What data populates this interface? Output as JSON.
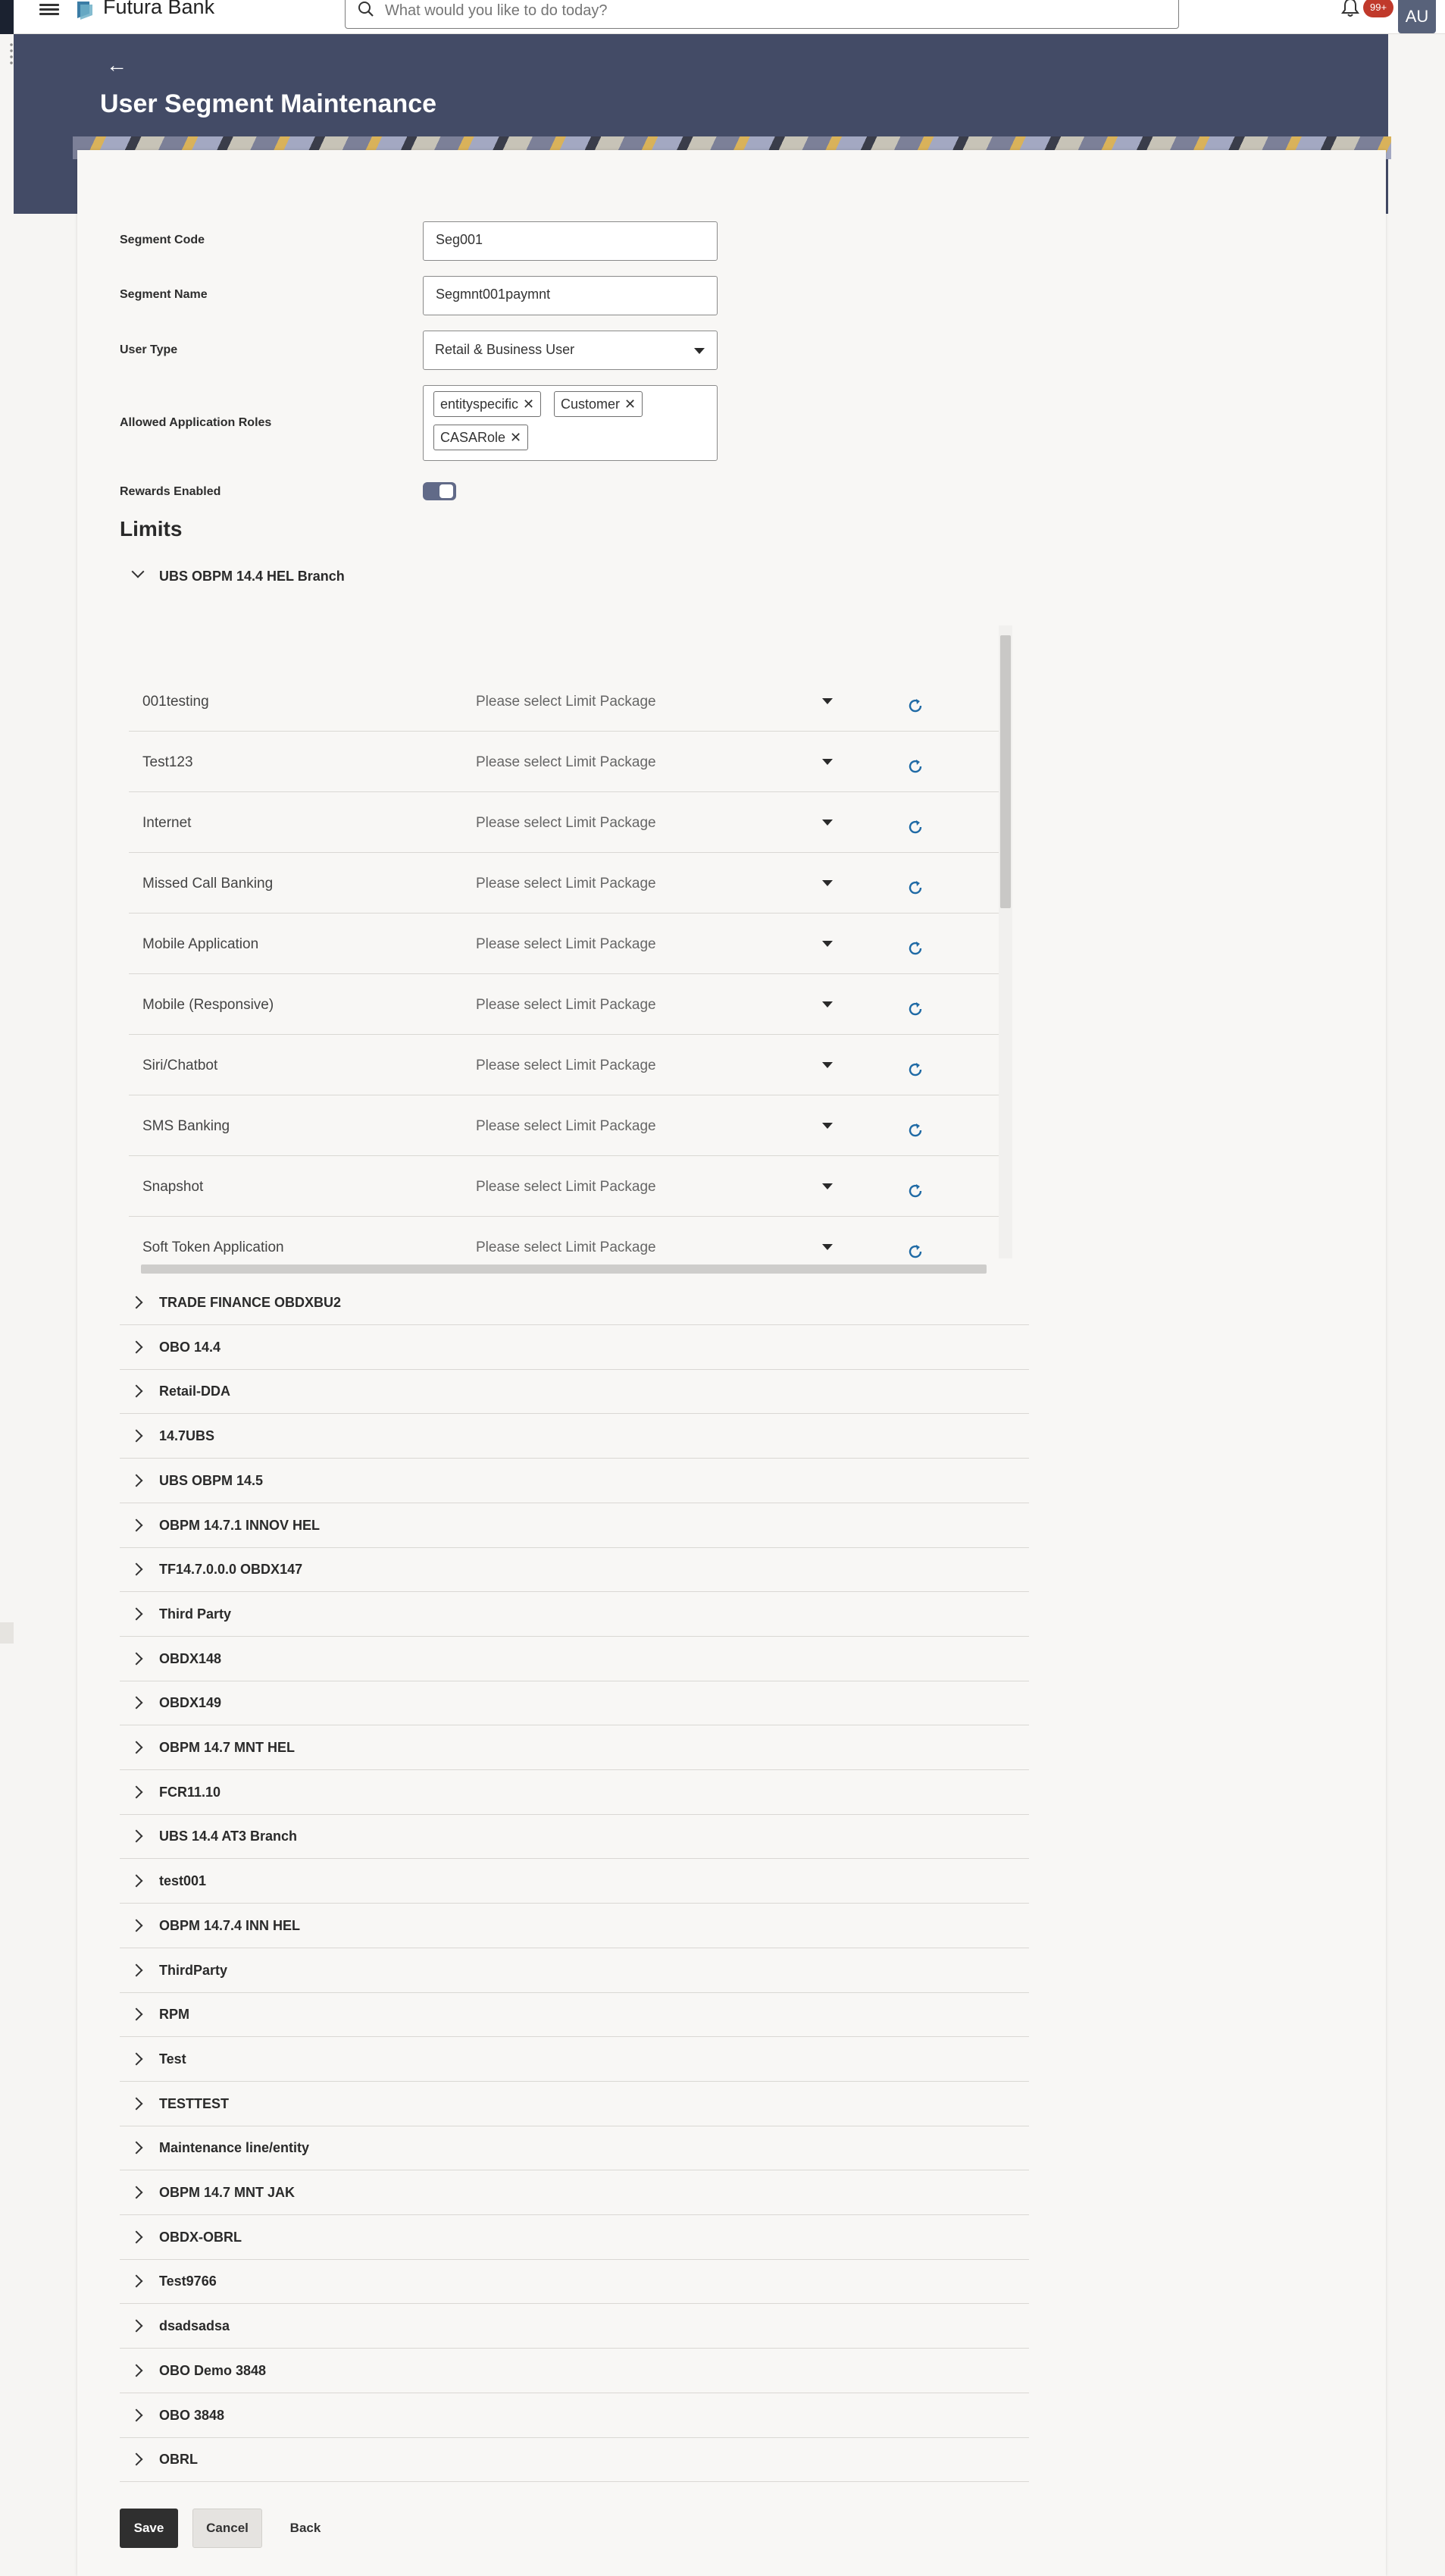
{
  "app": {
    "brand": "Futura Bank",
    "search_placeholder": "What would you like to do today?",
    "notification_badge": "99+",
    "avatar_initials": "AU"
  },
  "page": {
    "back_arrow": "←",
    "title": "User Segment Maintenance"
  },
  "form": {
    "segment_code_label": "Segment Code",
    "segment_code_value": "Seg001",
    "segment_name_label": "Segment Name",
    "segment_name_value": "Segmnt001paymnt",
    "user_type_label": "User Type",
    "user_type_value": "Retail & Business User",
    "roles_label": "Allowed Application Roles",
    "roles": [
      "entityspecific",
      "Customer",
      "CASARole"
    ],
    "rewards_label": "Rewards Enabled",
    "rewards_enabled": true
  },
  "limits": {
    "title": "Limits",
    "expanded_group": "UBS OBPM 14.4 HEL Branch",
    "package_placeholder": "Please select Limit Package",
    "channels": [
      "001testing",
      "Test123",
      "Internet",
      "Missed Call Banking",
      "Mobile Application",
      "Mobile (Responsive)",
      "Siri/Chatbot",
      "SMS Banking",
      "Snapshot",
      "Soft Token Application"
    ],
    "groups": [
      "TRADE FINANCE OBDXBU2",
      "OBO 14.4",
      "Retail-DDA",
      "14.7UBS",
      "UBS OBPM 14.5",
      "OBPM 14.7.1 INNOV HEL",
      "TF14.7.0.0.0 OBDX147",
      "Third Party",
      "OBDX148",
      "OBDX149",
      "OBPM 14.7 MNT HEL",
      "FCR11.10",
      "UBS 14.4 AT3 Branch",
      "test001",
      "OBPM 14.7.4 INN HEL",
      "ThirdParty",
      "RPM",
      "Test",
      "TESTTEST",
      "Maintenance line/entity",
      "OBPM 14.7 MNT JAK",
      "OBDX-OBRL",
      "Test9766",
      "dsadsadsa",
      "OBO Demo 3848",
      "OBO 3848",
      "OBRL"
    ]
  },
  "actions": {
    "save": "Save",
    "cancel": "Cancel",
    "back": "Back"
  }
}
